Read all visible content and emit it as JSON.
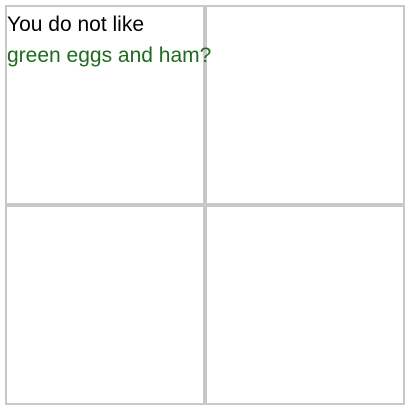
{
  "caption": {
    "line1": "You do not like",
    "line2": "green eggs and ham?"
  },
  "colors": {
    "text_primary": "#000000",
    "text_accent": "#1f6b1f",
    "grid_line": "#c8c8c8",
    "background": "#ffffff"
  }
}
